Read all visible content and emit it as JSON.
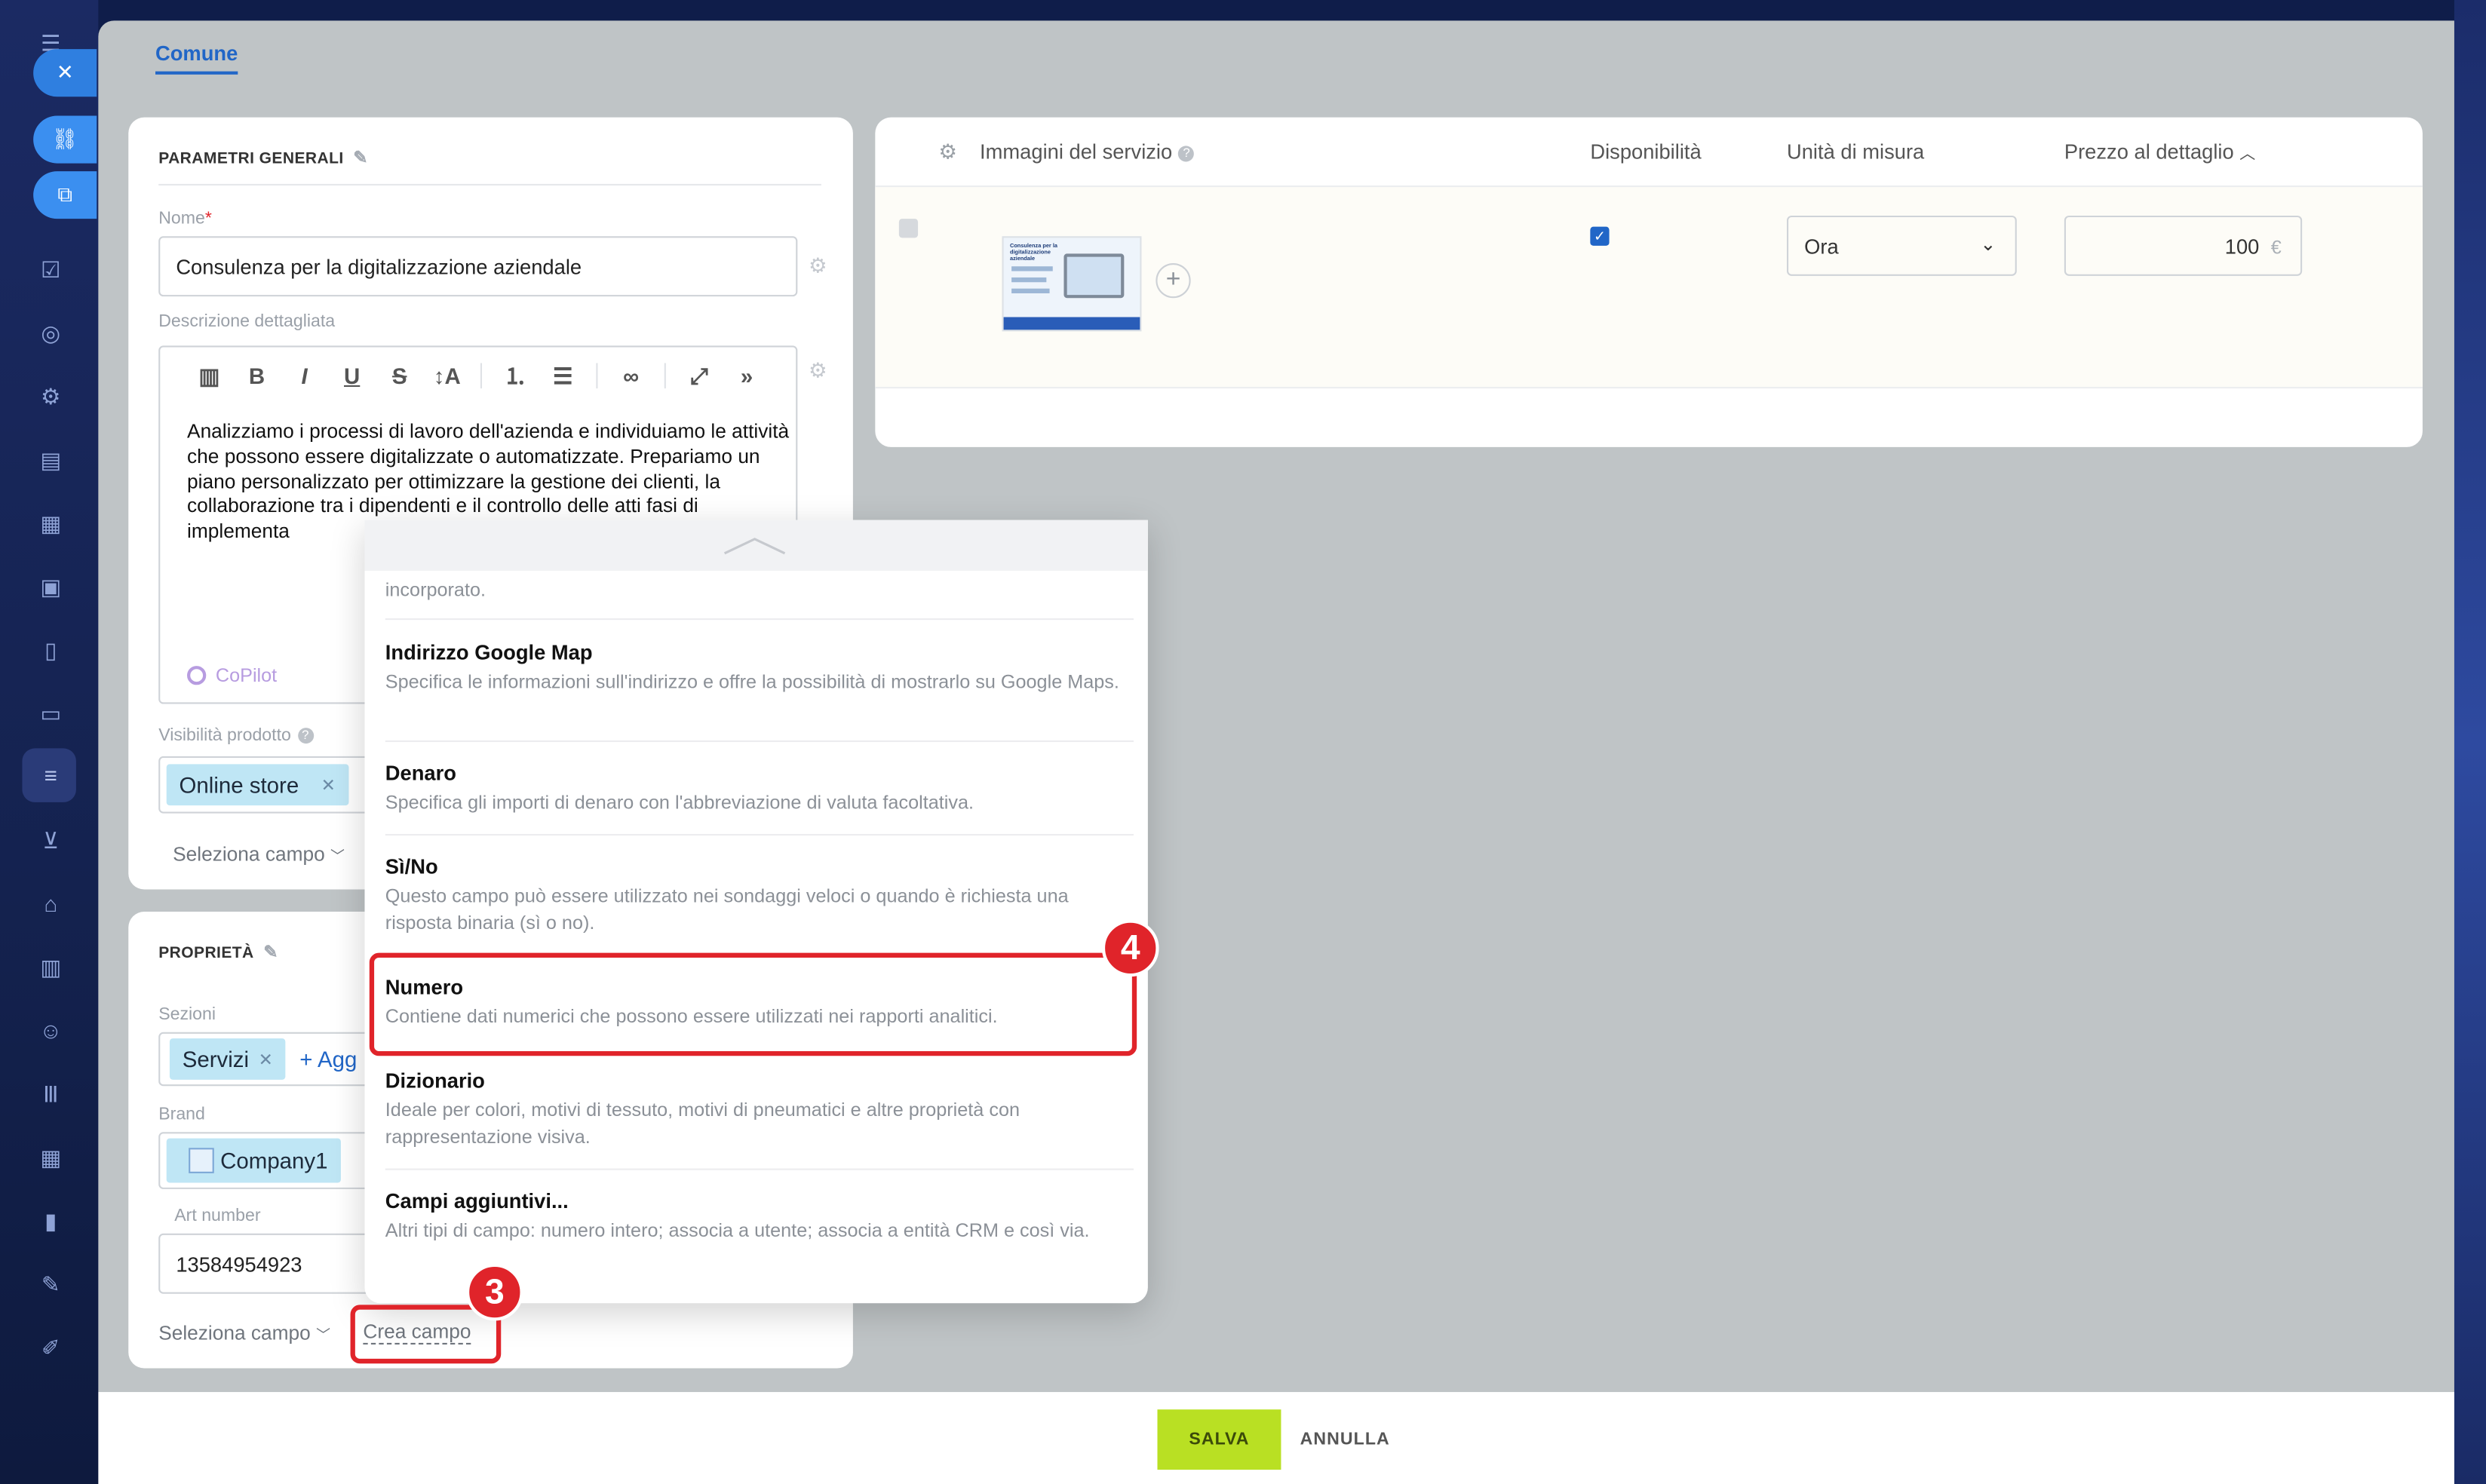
{
  "tabs": {
    "active": "Comune"
  },
  "general": {
    "section_title": "PARAMETRI GENERALI",
    "name_label": "Nome",
    "name_value": "Consulenza per la digitalizzazione aziendale",
    "desc_label": "Descrizione dettagliata",
    "desc_text": "Analizziamo i processi di lavoro dell'azienda e individuiamo le attività che possono essere digitalizzate o automatizzate. Prepariamo un piano personalizzato per ottimizzare la gestione dei clienti, la collaborazione tra i dipendenti e il controllo delle atti fasi di implementa",
    "copilot": "CoPilot",
    "visibility_label": "Visibilità prodotto",
    "visibility_tag": "Online store",
    "select_field": "Seleziona campo"
  },
  "toolbar": {
    "bold": "B",
    "italic": "I",
    "underline": "U",
    "strike": "S",
    "size": "↕A"
  },
  "properties": {
    "section_title": "PROPRIETÀ",
    "sections_label": "Sezioni",
    "sections_tag": "Servizi",
    "add": "+ Agg",
    "brand_label": "Brand",
    "brand_tag": "Company1",
    "art_label": "Art number",
    "art_value": "13584954923",
    "select_field": "Seleziona campo",
    "create_field": "Crea campo"
  },
  "table": {
    "col_images": "Immagini del servizio",
    "col_availability": "Disponibilità",
    "col_unit": "Unità di misura",
    "col_price": "Prezzo al dettaglio",
    "unit_value": "Ora",
    "price_value": "100",
    "currency": "€",
    "thumb_title": "Consulenza per la digitalizzazione aziendale"
  },
  "popup": {
    "items": [
      {
        "title": "",
        "desc": "incorporato."
      },
      {
        "title": "Indirizzo Google Map",
        "desc": "Specifica le informazioni sull'indirizzo e offre la possibilità di mostrarlo su Google Maps."
      },
      {
        "title": "Denaro",
        "desc": "Specifica gli importi di denaro con l'abbreviazione di valuta facoltativa."
      },
      {
        "title": "Sì/No",
        "desc": "Questo campo può essere utilizzato nei sondaggi veloci o quando è richiesta una risposta binaria (sì o no)."
      },
      {
        "title": "Numero",
        "desc": "Contiene dati numerici che possono essere utilizzati nei rapporti analitici."
      },
      {
        "title": "Dizionario",
        "desc": "Ideale per colori, motivi di tessuto, motivi di pneumatici e altre proprietà con rappresentazione visiva."
      },
      {
        "title": "Campi aggiuntivi...",
        "desc": "Altri tipi di campo: numero intero; associa a utente; associa a entità CRM e così via."
      }
    ]
  },
  "annotations": {
    "step3": "3",
    "step4": "4"
  },
  "footer": {
    "save": "SALVA",
    "cancel": "ANNULLA"
  },
  "colors": {
    "accent": "#2166c7",
    "highlight": "#e0242a",
    "save": "#b9e023"
  }
}
